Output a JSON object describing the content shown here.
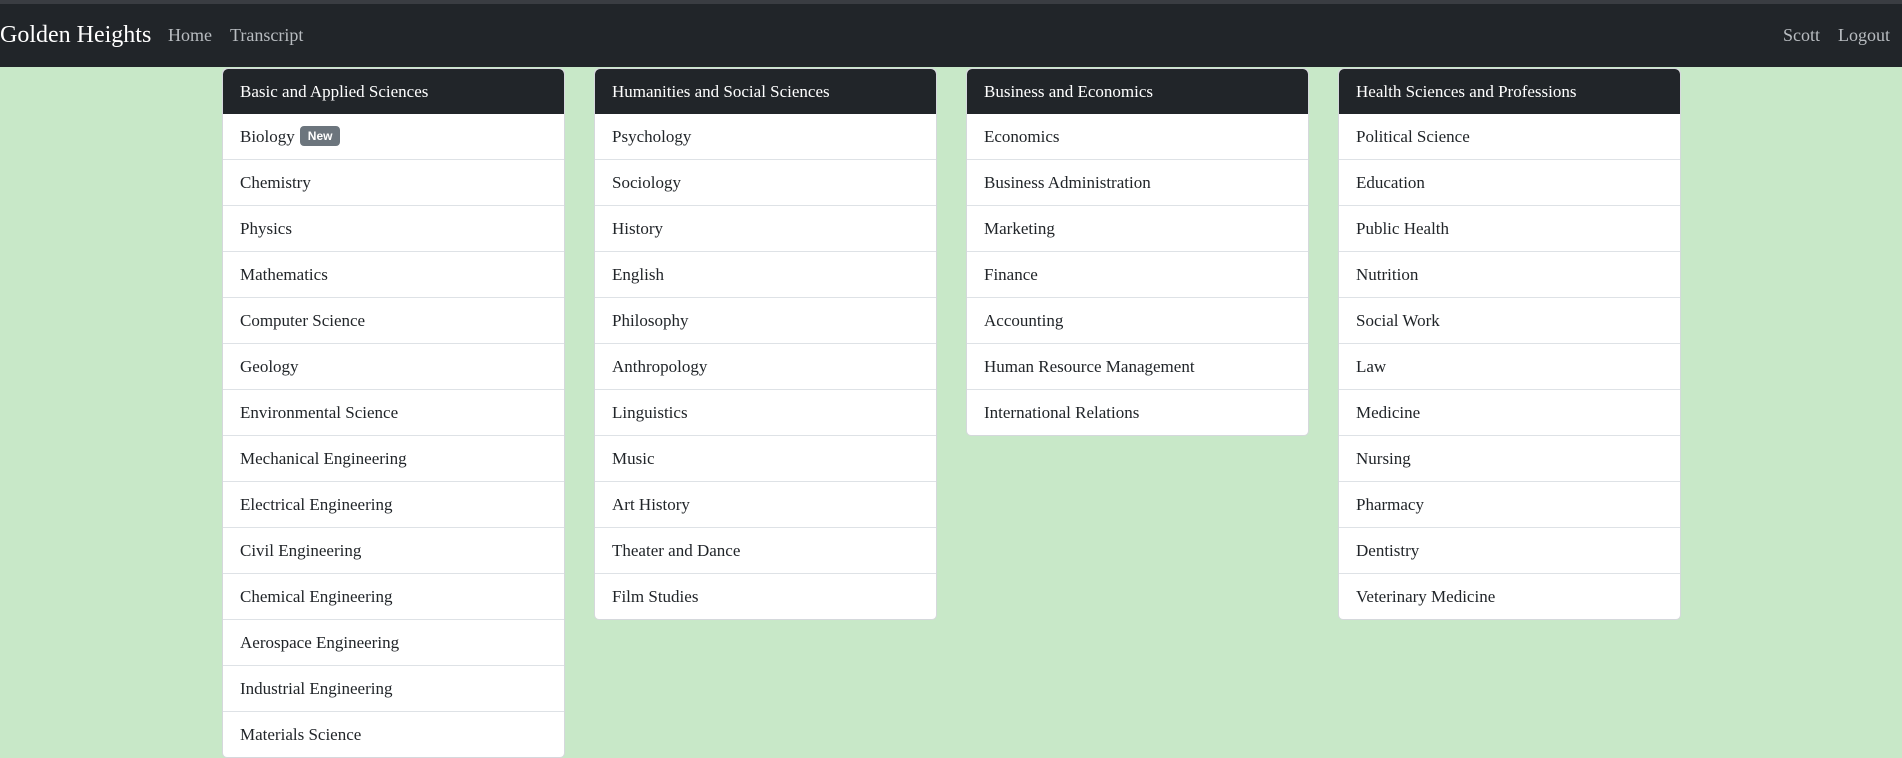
{
  "nav": {
    "brand": "Golden Heights",
    "links": [
      "Home",
      "Transcript"
    ],
    "user": "Scott",
    "logout": "Logout"
  },
  "cards": [
    {
      "title": "Basic and Applied Sciences",
      "items": [
        {
          "label": "Biology",
          "badge": "New"
        },
        {
          "label": "Chemistry"
        },
        {
          "label": "Physics"
        },
        {
          "label": "Mathematics"
        },
        {
          "label": "Computer Science"
        },
        {
          "label": "Geology"
        },
        {
          "label": "Environmental Science"
        },
        {
          "label": "Mechanical Engineering"
        },
        {
          "label": "Electrical Engineering"
        },
        {
          "label": "Civil Engineering"
        },
        {
          "label": "Chemical Engineering"
        },
        {
          "label": "Aerospace Engineering"
        },
        {
          "label": "Industrial Engineering"
        },
        {
          "label": "Materials Science"
        }
      ]
    },
    {
      "title": "Humanities and Social Sciences",
      "items": [
        {
          "label": "Psychology"
        },
        {
          "label": "Sociology"
        },
        {
          "label": "History"
        },
        {
          "label": "English"
        },
        {
          "label": "Philosophy"
        },
        {
          "label": "Anthropology"
        },
        {
          "label": "Linguistics"
        },
        {
          "label": "Music"
        },
        {
          "label": "Art History"
        },
        {
          "label": "Theater and Dance"
        },
        {
          "label": "Film Studies"
        }
      ]
    },
    {
      "title": "Business and Economics",
      "items": [
        {
          "label": "Economics"
        },
        {
          "label": "Business Administration"
        },
        {
          "label": "Marketing"
        },
        {
          "label": "Finance"
        },
        {
          "label": "Accounting"
        },
        {
          "label": "Human Resource Management"
        },
        {
          "label": "International Relations"
        }
      ]
    },
    {
      "title": "Health Sciences and Professions",
      "items": [
        {
          "label": "Political Science"
        },
        {
          "label": "Education"
        },
        {
          "label": "Public Health"
        },
        {
          "label": "Nutrition"
        },
        {
          "label": "Social Work"
        },
        {
          "label": "Law"
        },
        {
          "label": "Medicine"
        },
        {
          "label": "Nursing"
        },
        {
          "label": "Pharmacy"
        },
        {
          "label": "Dentistry"
        },
        {
          "label": "Veterinary Medicine"
        }
      ]
    }
  ]
}
